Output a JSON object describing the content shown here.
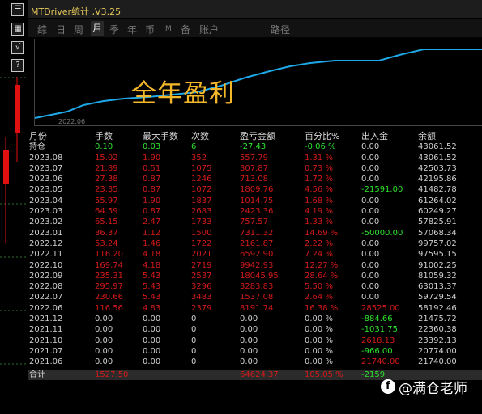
{
  "window": {
    "title": "MTDriver统计 ,V3.25"
  },
  "side_buttons": [
    "☰",
    "▦",
    "√",
    "?"
  ],
  "tabs": [
    {
      "label": "综",
      "active": false
    },
    {
      "label": "日",
      "active": false
    },
    {
      "label": "周",
      "active": false
    },
    {
      "label": "月",
      "active": true
    },
    {
      "label": "季",
      "active": false
    },
    {
      "label": "年",
      "active": false
    },
    {
      "label": "币",
      "active": false
    },
    {
      "label": "M",
      "active": false
    },
    {
      "label": "备",
      "active": false
    },
    {
      "label": "账户",
      "active": false
    },
    {
      "label": "路径",
      "active": false
    }
  ],
  "chart": {
    "overlay_text": "全年盈利",
    "x_tick": "2022.06",
    "line_color": "#1fa8e8"
  },
  "table": {
    "headers": [
      "月份",
      "手数",
      "最大手数",
      "次数",
      "盈亏金额",
      "百分比%",
      "出入金",
      "余额"
    ],
    "rows": [
      {
        "month": "持仓",
        "lots": "0.10",
        "max_lots": "0.03",
        "trades": "6",
        "pnl": "-27.43",
        "pct": "-0.06 %",
        "flow": "0.00",
        "balance": "43061.52",
        "style": "holding"
      },
      {
        "month": "2023.08",
        "lots": "15.02",
        "max_lots": "1.90",
        "trades": "352",
        "pnl": "557.79",
        "pct": "1.31 %",
        "flow": "0.00",
        "balance": "43061.52",
        "style": "profit"
      },
      {
        "month": "2023.07",
        "lots": "21.89",
        "max_lots": "0.51",
        "trades": "1075",
        "pnl": "307.87",
        "pct": "0.73 %",
        "flow": "0.00",
        "balance": "42503.73",
        "style": "profit"
      },
      {
        "month": "2023.06",
        "lots": "27.38",
        "max_lots": "0.87",
        "trades": "1246",
        "pnl": "713.08",
        "pct": "1.72 %",
        "flow": "0.00",
        "balance": "42195.86",
        "style": "profit"
      },
      {
        "month": "2023.05",
        "lots": "23.35",
        "max_lots": "0.87",
        "trades": "1072",
        "pnl": "1809.76",
        "pct": "4.56 %",
        "flow": "-21591.00",
        "balance": "41482.78",
        "style": "profit",
        "flow_color": "green"
      },
      {
        "month": "2023.04",
        "lots": "55.97",
        "max_lots": "1.90",
        "trades": "1837",
        "pnl": "1014.75",
        "pct": "1.68 %",
        "flow": "0.00",
        "balance": "61264.02",
        "style": "profit"
      },
      {
        "month": "2023.03",
        "lots": "64.59",
        "max_lots": "0.87",
        "trades": "2683",
        "pnl": "2423.36",
        "pct": "4.19 %",
        "flow": "0.00",
        "balance": "60249.27",
        "style": "profit"
      },
      {
        "month": "2023.02",
        "lots": "65.15",
        "max_lots": "2.47",
        "trades": "1733",
        "pnl": "757.57",
        "pct": "1.33 %",
        "flow": "0.00",
        "balance": "57825.91",
        "style": "profit"
      },
      {
        "month": "2023.01",
        "lots": "36.37",
        "max_lots": "1.12",
        "trades": "1500",
        "pnl": "7311.32",
        "pct": "14.69 %",
        "flow": "-50000.00",
        "balance": "57068.34",
        "style": "profit",
        "flow_color": "green"
      },
      {
        "month": "2022.12",
        "lots": "53.24",
        "max_lots": "1.46",
        "trades": "1722",
        "pnl": "2161.87",
        "pct": "2.22 %",
        "flow": "0.00",
        "balance": "99757.02",
        "style": "profit"
      },
      {
        "month": "2022.11",
        "lots": "116.20",
        "max_lots": "4.18",
        "trades": "2021",
        "pnl": "6592.90",
        "pct": "7.24 %",
        "flow": "0.00",
        "balance": "97595.15",
        "style": "profit"
      },
      {
        "month": "2022.10",
        "lots": "169.74",
        "max_lots": "4.18",
        "trades": "2719",
        "pnl": "9942.93",
        "pct": "12.27 %",
        "flow": "0.00",
        "balance": "91002.25",
        "style": "profit"
      },
      {
        "month": "2022.09",
        "lots": "235.31",
        "max_lots": "5.43",
        "trades": "2537",
        "pnl": "18045.95",
        "pct": "28.64 %",
        "flow": "0.00",
        "balance": "81059.32",
        "style": "profit"
      },
      {
        "month": "2022.08",
        "lots": "295.97",
        "max_lots": "5.43",
        "trades": "3296",
        "pnl": "3283.83",
        "pct": "5.50 %",
        "flow": "0.00",
        "balance": "63013.37",
        "style": "profit"
      },
      {
        "month": "2022.07",
        "lots": "230.66",
        "max_lots": "5.43",
        "trades": "3483",
        "pnl": "1537.08",
        "pct": "2.64 %",
        "flow": "0.00",
        "balance": "59729.54",
        "style": "profit"
      },
      {
        "month": "2022.06",
        "lots": "116.56",
        "max_lots": "4.83",
        "trades": "2379",
        "pnl": "8191.74",
        "pct": "16.38 %",
        "flow": "28525.00",
        "balance": "58192.46",
        "style": "profit",
        "flow_color": "red"
      },
      {
        "month": "2021.12",
        "lots": "0.00",
        "max_lots": "0.00",
        "trades": "0",
        "pnl": "0.00",
        "pct": "0.00 %",
        "flow": "-884.66",
        "balance": "21475.72",
        "style": "zero",
        "flow_color": "green"
      },
      {
        "month": "2021.11",
        "lots": "0.00",
        "max_lots": "0.00",
        "trades": "0",
        "pnl": "0.00",
        "pct": "0.00 %",
        "flow": "-1031.75",
        "balance": "22360.38",
        "style": "zero",
        "flow_color": "green"
      },
      {
        "month": "2021.10",
        "lots": "0.00",
        "max_lots": "0.00",
        "trades": "0",
        "pnl": "0.00",
        "pct": "0.00 %",
        "flow": "2618.13",
        "balance": "23392.13",
        "style": "zero",
        "flow_color": "red"
      },
      {
        "month": "2021.07",
        "lots": "0.00",
        "max_lots": "0.00",
        "trades": "0",
        "pnl": "0.00",
        "pct": "0.00 %",
        "flow": "-966.00",
        "balance": "20774.00",
        "style": "zero",
        "flow_color": "green"
      },
      {
        "month": "2021.06",
        "lots": "0.00",
        "max_lots": "0.00",
        "trades": "0",
        "pnl": "0.00",
        "pct": "0.00 %",
        "flow": "21740.00",
        "balance": "21740.00",
        "style": "zero",
        "flow_color": "red"
      }
    ],
    "total": {
      "month": "合计",
      "lots": "1527.50",
      "max_lots": "",
      "trades": "",
      "pnl": "64624.37",
      "pct": "105.05 %",
      "flow": "-2159",
      "balance": ""
    }
  },
  "watermark": {
    "icon": "facebook-icon",
    "text": "@满仓老师"
  }
}
